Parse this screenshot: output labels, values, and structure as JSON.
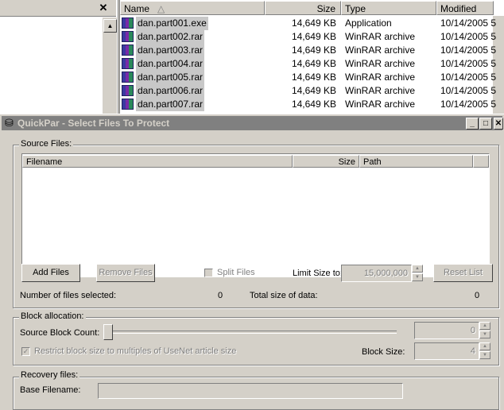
{
  "explorer": {
    "columns": {
      "name": "Name",
      "size": "Size",
      "type": "Type",
      "modified": "Modified"
    },
    "files": [
      {
        "name": "dan.part001.exe",
        "size": "14,649 KB",
        "type": "Application",
        "modified": "10/14/2005 5"
      },
      {
        "name": "dan.part002.rar",
        "size": "14,649 KB",
        "type": "WinRAR archive",
        "modified": "10/14/2005 5"
      },
      {
        "name": "dan.part003.rar",
        "size": "14,649 KB",
        "type": "WinRAR archive",
        "modified": "10/14/2005 5"
      },
      {
        "name": "dan.part004.rar",
        "size": "14,649 KB",
        "type": "WinRAR archive",
        "modified": "10/14/2005 5"
      },
      {
        "name": "dan.part005.rar",
        "size": "14,649 KB",
        "type": "WinRAR archive",
        "modified": "10/14/2005 5"
      },
      {
        "name": "dan.part006.rar",
        "size": "14,649 KB",
        "type": "WinRAR archive",
        "modified": "10/14/2005 5"
      },
      {
        "name": "dan.part007.rar",
        "size": "14,649 KB",
        "type": "WinRAR archive",
        "modified": "10/14/2005 5"
      }
    ],
    "close_glyph": "✕"
  },
  "dialog": {
    "title": "QuickPar - Select Files To Protect",
    "source": {
      "label": "Source Files:",
      "col_filename": "Filename",
      "col_size": "Size",
      "col_path": "Path",
      "add_files": "Add Files",
      "remove_files": "Remove Files",
      "split_files": "Split Files",
      "limit_size_label": "Limit Size to:",
      "limit_size_value": "15,000,000",
      "reset_list": "Reset List",
      "files_selected_label": "Number of files selected:",
      "files_selected_value": "0",
      "total_size_label": "Total size of data:",
      "total_size_value": "0"
    },
    "block": {
      "label": "Block allocation:",
      "source_block_count_label": "Source Block Count:",
      "source_block_count_value": "0",
      "restrict_label": "Restrict block size to multiples of UseNet article size",
      "block_size_label": "Block Size:",
      "block_size_value": "4"
    },
    "recovery": {
      "label": "Recovery files:",
      "base_filename_label": "Base Filename:"
    }
  }
}
